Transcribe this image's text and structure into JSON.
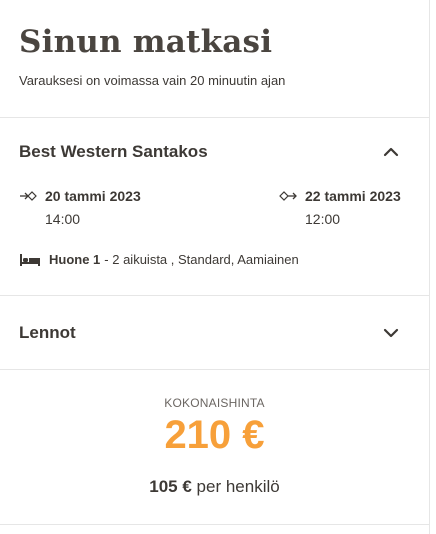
{
  "header": {
    "title": "Sinun matkasi",
    "subtitle": "Varauksesi on voimassa vain 20 minuutin ajan"
  },
  "hotel": {
    "name": "Best Western Santakos",
    "expanded": true,
    "checkin": {
      "date": "20 tammi 2023",
      "time": "14:00",
      "icon": "check-in-icon"
    },
    "checkout": {
      "date": "22 tammi 2023",
      "time": "12:00",
      "icon": "check-out-icon"
    },
    "room": {
      "icon": "bed-icon",
      "name": "Huone 1",
      "details": "- 2 aikuista , Standard, Aamiainen"
    }
  },
  "flights": {
    "label": "Lennot",
    "expanded": false
  },
  "total": {
    "label": "KOKONAISHINTA",
    "price": "210 €",
    "per_person_amount": "105 €",
    "per_person_suffix": "per henkilö"
  },
  "colors": {
    "accent": "#f7a03a",
    "text": "#3d3935",
    "divider": "#e6e6e6"
  }
}
